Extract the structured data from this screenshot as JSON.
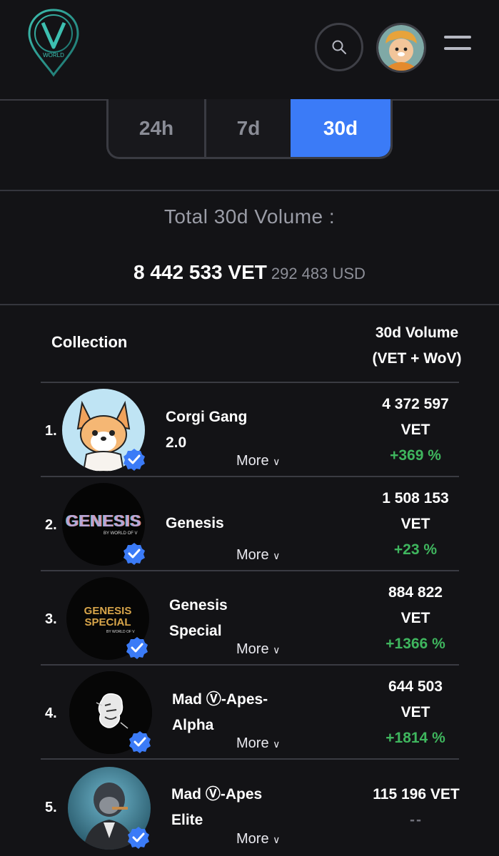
{
  "header": {
    "logo_icon": "world-of-v-logo-icon",
    "logo_text": "WORLD",
    "search_icon": "search-icon",
    "avatar_icon": "avatar-icon",
    "menu_icon": "hamburger-menu-icon"
  },
  "tabs": [
    {
      "label": "24h",
      "active": false
    },
    {
      "label": "7d",
      "active": false
    },
    {
      "label": "30d",
      "active": true
    }
  ],
  "colors": {
    "accent": "#3b7bf7",
    "positive": "#3fb65e",
    "background": "#131316"
  },
  "total": {
    "label": "Total 30d Volume :",
    "vet": "8 442 533 VET",
    "usd": "292 483 USD"
  },
  "table": {
    "col_collection": "Collection",
    "col_volume_line1": "30d Volume",
    "col_volume_line2": "(VET + WoV)",
    "rows": [
      {
        "rank": "1.",
        "name_line1": "Corgi Gang",
        "name_line2": "2.0",
        "more": "More",
        "vol_line1": "4 372 597",
        "vol_line2": "VET",
        "change": "+369 %"
      },
      {
        "rank": "2.",
        "name_line1": "Genesis",
        "name_line2": "",
        "more": "More",
        "vol_line1": "1 508 153",
        "vol_line2": "VET",
        "change": "+23 %",
        "thumb_text": "GENESIS",
        "thumb_sub": "BY WORLD OF V"
      },
      {
        "rank": "3.",
        "name_line1": "Genesis",
        "name_line2": "Special",
        "more": "More",
        "vol_line1": "884 822",
        "vol_line2": "VET",
        "change": "+1366 %",
        "thumb_text1": "GENESIS",
        "thumb_text2": "SPECIAL",
        "thumb_sub": "BY WORLD OF V"
      },
      {
        "rank": "4.",
        "name_line1": "Mad Ⓥ-Apes-",
        "name_line2": "Alpha",
        "more": "More",
        "vol_line1": "644 503",
        "vol_line2": "VET",
        "change": "+1814 %"
      },
      {
        "rank": "5.",
        "name_line1": "Mad Ⓥ-Apes",
        "name_line2": "Elite",
        "more": "More",
        "vol_line1": "115 196 VET",
        "vol_line2": "",
        "change": "--"
      }
    ]
  }
}
